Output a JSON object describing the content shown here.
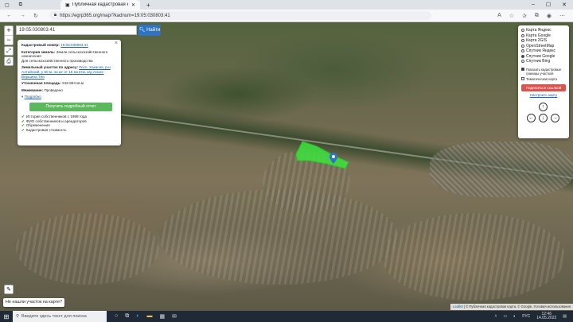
{
  "browser": {
    "tab_title": "Публичная кадастровая карта",
    "url": "https://egrp365.org/map/?kadnum=19:05:030803:41",
    "new_tab": "+",
    "win_controls": [
      "–",
      "☐",
      "✕"
    ]
  },
  "search": {
    "value": "19:05:030803:41",
    "button": "Найти"
  },
  "zoom": {
    "in": "+",
    "out": "−"
  },
  "popup": {
    "close": "×",
    "kadnum_label": "Кадастровый номер:",
    "kadnum_value": "19:05:030803:41",
    "category_label": "Категория земель:",
    "category_value": "Земли сельскохозяйственного назначения",
    "use_value": "Для сельскохозяйственного производства",
    "address_label": "Земельный участок по адресу:",
    "address_value": "Респ. Хакасия, р-н Алтайский, у 50 м. на юг от 15 км втм. а/д Аскиз-Вершина Тёи",
    "area_label": "Уточненная площадь:",
    "area_value": "918 804 кв.м",
    "boundary_label": "Межевание:",
    "boundary_value": "Проведено",
    "more_link": "Подробно",
    "report_button": "Получить подробный отчет",
    "features": [
      "История собственников с 1998 года",
      "ФИО собственников и арендаторов",
      "Обременения",
      "Кадастровая стоимость"
    ]
  },
  "layers": {
    "options": [
      {
        "label": "Карта Яндекс",
        "selected": false
      },
      {
        "label": "Карта Google",
        "selected": false
      },
      {
        "label": "Карта 2GIS",
        "selected": false
      },
      {
        "label": "OpenStreetMap",
        "selected": false
      },
      {
        "label": "Спутник Яндекс",
        "selected": false
      },
      {
        "label": "Спутник Google",
        "selected": true
      },
      {
        "label": "Спутник Bing",
        "selected": false
      }
    ],
    "show_borders": "Показать кадастровые границы участков",
    "thematic": "Тематическая карта",
    "share_button": "Поделиться ссылкой",
    "setup_link": "Настроить карту"
  },
  "help_text": "Не нашли участок на карте?",
  "attribution": {
    "leaflet": "Leaflet",
    "rest": "© Публичная кадастровая карта, © Google, Условия использования"
  },
  "taskbar": {
    "search_placeholder": "Введите здесь текст для поиска",
    "time": "12:46",
    "date": "14.05.2022"
  },
  "colors": {
    "parcel": "#3ee33e",
    "search_button": "#2f73c4",
    "report_button": "#5cb85c",
    "share_button": "#d9534f"
  },
  "icons": {
    "back": "arrow-left-icon",
    "forward": "arrow-right-icon",
    "reload": "reload-icon",
    "lock": "lock-icon",
    "layers": "layers-icon",
    "fullscreen": "fullscreen-icon",
    "print": "print-icon",
    "pencil": "pencil-icon",
    "pin": "location-pin-icon"
  }
}
